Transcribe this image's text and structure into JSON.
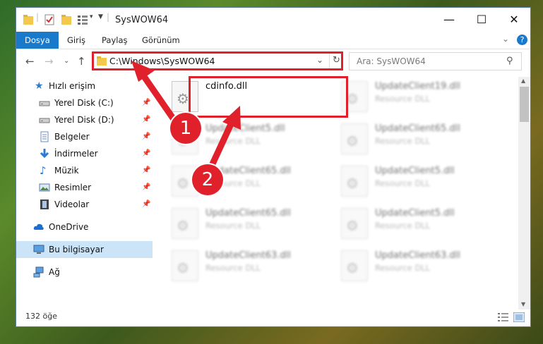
{
  "window": {
    "title": "SysWOW64",
    "controls": {
      "minimize": "—",
      "maximize": "☐",
      "close": "✕"
    }
  },
  "ribbon": {
    "tabs": [
      "Dosya",
      "Giriş",
      "Paylaş",
      "Görünüm"
    ],
    "expand_icon": "chevron-down-icon",
    "help": "?"
  },
  "address": {
    "path": "C:\\Windows\\SysWOW64",
    "search_placeholder": "Ara: SysWOW64"
  },
  "nav": {
    "items": [
      {
        "label": "Hızlı erişim",
        "icon": "star-icon",
        "pinned": false
      },
      {
        "label": "Yerel Disk (C:)",
        "icon": "drive-icon",
        "pinned": true
      },
      {
        "label": "Yerel Disk (D:)",
        "icon": "drive-icon",
        "pinned": true
      },
      {
        "label": "Belgeler",
        "icon": "document-icon",
        "pinned": true
      },
      {
        "label": "İndirmeler",
        "icon": "download-icon",
        "pinned": true
      },
      {
        "label": "Müzik",
        "icon": "music-icon",
        "pinned": true
      },
      {
        "label": "Resimler",
        "icon": "picture-icon",
        "pinned": true
      },
      {
        "label": "Videolar",
        "icon": "video-icon",
        "pinned": true
      },
      {
        "label": "OneDrive",
        "icon": "cloud-icon",
        "pinned": false
      },
      {
        "label": "Bu bilgisayar",
        "icon": "computer-icon",
        "pinned": false
      },
      {
        "label": "Ağ",
        "icon": "network-icon",
        "pinned": false
      }
    ]
  },
  "files": [
    {
      "name": "cdinfo.dll",
      "type": ""
    },
    {
      "name": "UpdateClient19.dll",
      "type": "Resource DLL"
    },
    {
      "name": "UpdateClient5.dll",
      "type": "Resource DLL"
    },
    {
      "name": "UpdateClient65.dll",
      "type": "Resource DLL"
    },
    {
      "name": "UpdateClient65.dll",
      "type": "Resource DLL"
    },
    {
      "name": "UpdateClient5.dll",
      "type": "Resource DLL"
    },
    {
      "name": "UpdateClient65.dll",
      "type": "Resource DLL"
    },
    {
      "name": "UpdateClient5.dll",
      "type": "Resource DLL"
    },
    {
      "name": "UpdateClient63.dll",
      "type": "Resource DLL"
    },
    {
      "name": "UpdateClient63.dll",
      "type": "Resource DLL"
    }
  ],
  "status": {
    "count": "132 öğe"
  },
  "annotations": {
    "step1": "1",
    "step2": "2",
    "color": "#e0212b"
  }
}
